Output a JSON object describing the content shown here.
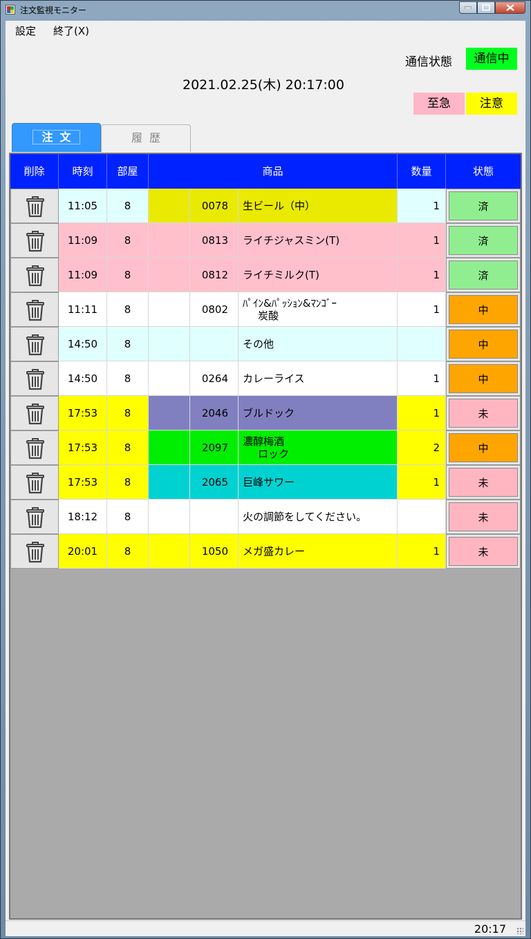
{
  "window": {
    "title": "注文監視モニター"
  },
  "menu": [
    {
      "label": "設定"
    },
    {
      "label": "終了(X)"
    }
  ],
  "comm": {
    "label": "通信状態",
    "status": "通信中"
  },
  "datetime": "2021.02.25(木) 20:17:00",
  "legend": {
    "urgent": "至急",
    "caution": "注意"
  },
  "tabs": [
    {
      "label": "注文"
    },
    {
      "label": "履歴"
    }
  ],
  "columns": {
    "delete": "削除",
    "time": "時刻",
    "room": "部屋",
    "item": "商品",
    "qty": "数量",
    "status": "状態"
  },
  "colors": {
    "done": "#90ee90",
    "inprogress": "#ffa500",
    "pending": "#ffb6c1",
    "header": "#0022ff",
    "caution": "#ffff00"
  },
  "rows": [
    {
      "time": "11:05",
      "room": "8",
      "code": "0078",
      "name": "生ビール（中）",
      "name2": "",
      "qty": "1",
      "status": "済",
      "status_color": "#90ee90",
      "row_color": "#e0ffff",
      "item_color": "#eaea00",
      "qty_color": "#e0ffff"
    },
    {
      "time": "11:09",
      "room": "8",
      "code": "0813",
      "name": "ライチジャスミン(T)",
      "name2": "",
      "qty": "1",
      "status": "済",
      "status_color": "#90ee90",
      "row_color": "#ffc0cb",
      "item_color": "#ffc0cb",
      "qty_color": "#ffc0cb"
    },
    {
      "time": "11:09",
      "room": "8",
      "code": "0812",
      "name": "ライチミルク(T)",
      "name2": "",
      "qty": "1",
      "status": "済",
      "status_color": "#90ee90",
      "row_color": "#ffc0cb",
      "item_color": "#ffc0cb",
      "qty_color": "#ffc0cb"
    },
    {
      "time": "11:11",
      "room": "8",
      "code": "0802",
      "name": "ﾊﾟｲﾝ&ﾊﾟｯｼｮﾝ&ﾏﾝｺﾞｰ",
      "name2": "炭酸",
      "qty": "1",
      "status": "中",
      "status_color": "#ffa500",
      "row_color": "#ffffff",
      "item_color": "#ffffff",
      "qty_color": "#ffffff"
    },
    {
      "time": "14:50",
      "room": "8",
      "code": "",
      "name": "その他",
      "name2": "",
      "qty": "",
      "status": "中",
      "status_color": "#ffa500",
      "row_color": "#e0ffff",
      "item_color": "#e0ffff",
      "qty_color": "#e0ffff"
    },
    {
      "time": "14:50",
      "room": "8",
      "code": "0264",
      "name": "カレーライス",
      "name2": "",
      "qty": "1",
      "status": "中",
      "status_color": "#ffa500",
      "row_color": "#ffffff",
      "item_color": "#ffffff",
      "qty_color": "#ffffff"
    },
    {
      "time": "17:53",
      "room": "8",
      "code": "2046",
      "name": "ブルドック",
      "name2": "",
      "qty": "1",
      "status": "未",
      "status_color": "#ffb6c1",
      "row_color": "#ffff00",
      "item_color": "#8080c0",
      "qty_color": "#ffff00"
    },
    {
      "time": "17:53",
      "room": "8",
      "code": "2097",
      "name": "濃醇梅酒",
      "name2": "ロック",
      "qty": "2",
      "status": "中",
      "status_color": "#ffa500",
      "row_color": "#ffff00",
      "item_color": "#00ee00",
      "qty_color": "#ffff00"
    },
    {
      "time": "17:53",
      "room": "8",
      "code": "2065",
      "name": "巨峰サワー",
      "name2": "",
      "qty": "1",
      "status": "未",
      "status_color": "#ffb6c1",
      "row_color": "#ffff00",
      "item_color": "#00d2d2",
      "qty_color": "#ffff00"
    },
    {
      "time": "18:12",
      "room": "8",
      "code": "",
      "name": "火の調節をしてください。",
      "name2": "",
      "qty": "",
      "status": "未",
      "status_color": "#ffb6c1",
      "row_color": "#ffffff",
      "item_color": "#ffffff",
      "qty_color": "#ffffff"
    },
    {
      "time": "20:01",
      "room": "8",
      "code": "1050",
      "name": "メガ盛カレー",
      "name2": "",
      "qty": "1",
      "status": "未",
      "status_color": "#ffb6c1",
      "row_color": "#ffff00",
      "item_color": "#ffff00",
      "qty_color": "#ffff00"
    }
  ],
  "statusbar": {
    "time": "20:17"
  }
}
